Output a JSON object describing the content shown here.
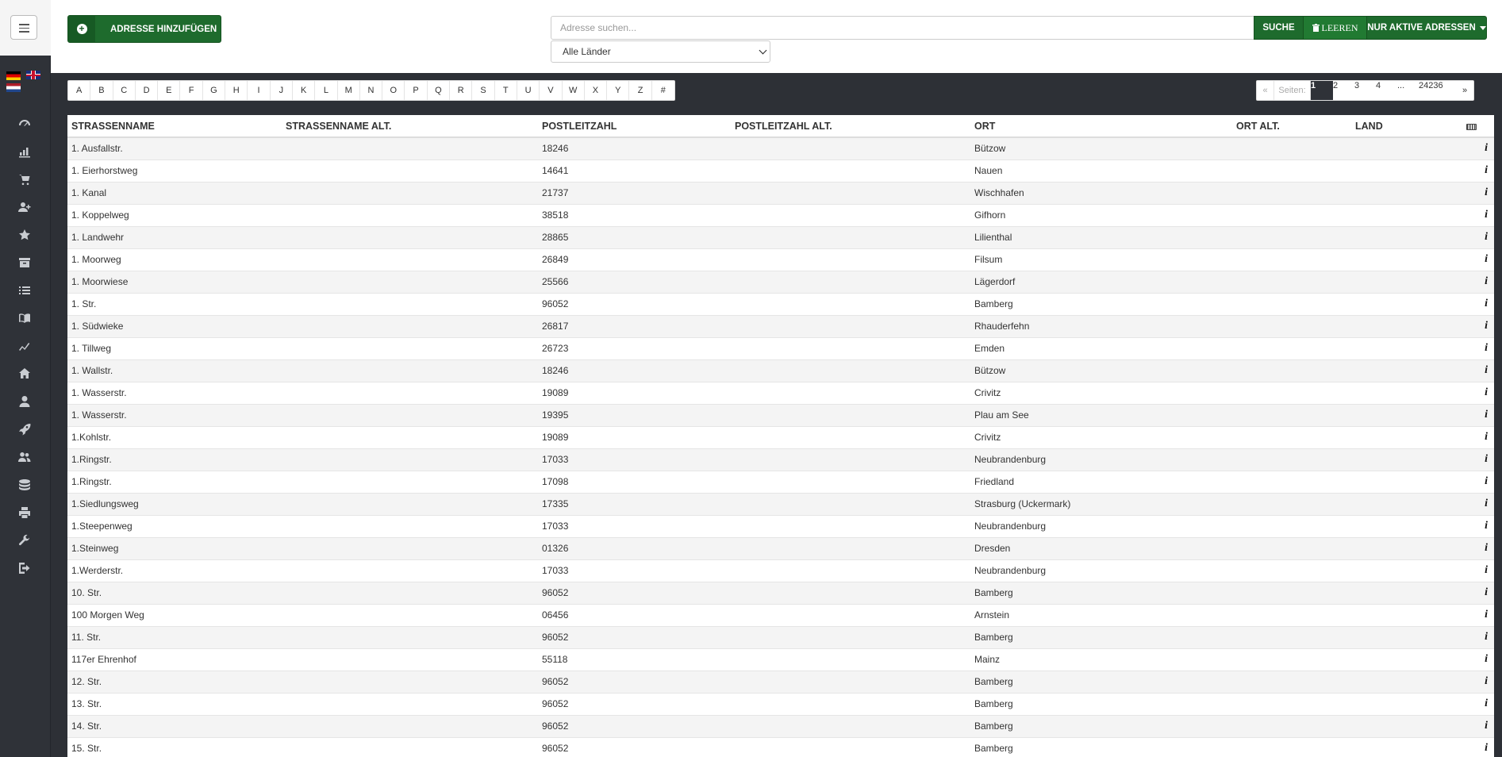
{
  "header": {
    "add_button_label": "ADRESSE HINZUFÜGEN",
    "search_placeholder": "Adresse suchen...",
    "search_value": "",
    "search_button_label": "SUCHE",
    "clear_button_label": "LEEREN",
    "active_filter_label": "NUR AKTIVE ADRESSEN",
    "country_selected": "Alle Länder"
  },
  "sidebar": {
    "languages": [
      "de",
      "en",
      "nl"
    ],
    "icons": [
      "dashboard-icon",
      "bar-chart-icon",
      "cart-icon",
      "user-plus-icon",
      "star-icon",
      "archive-icon",
      "list-icon",
      "book-icon",
      "line-chart-icon",
      "home-icon",
      "user-icon",
      "rocket-icon",
      "users-icon",
      "database-icon",
      "print-icon",
      "wrench-icon",
      "logout-icon"
    ]
  },
  "alphabet": [
    "A",
    "B",
    "C",
    "D",
    "E",
    "F",
    "G",
    "H",
    "I",
    "J",
    "K",
    "L",
    "M",
    "N",
    "O",
    "P",
    "Q",
    "R",
    "S",
    "T",
    "U",
    "V",
    "W",
    "X",
    "Y",
    "Z",
    "#"
  ],
  "pagination": {
    "prev": "«",
    "label": "Seiten:",
    "pages": [
      "1",
      "2",
      "3",
      "4",
      "...",
      "24236"
    ],
    "current": "1",
    "next": "»"
  },
  "table": {
    "columns": [
      "STRASSENNAME",
      "STRASSENNAME ALT.",
      "POSTLEITZAHL",
      "POSTLEITZAHL ALT.",
      "ORT",
      "ORT ALT.",
      "LAND"
    ],
    "rows": [
      [
        "1. Ausfallstr.",
        "",
        "18246",
        "",
        "Bützow",
        "",
        ""
      ],
      [
        "1. Eierhorstweg",
        "",
        "14641",
        "",
        "Nauen",
        "",
        ""
      ],
      [
        "1. Kanal",
        "",
        "21737",
        "",
        "Wischhafen",
        "",
        ""
      ],
      [
        "1. Koppelweg",
        "",
        "38518",
        "",
        "Gifhorn",
        "",
        ""
      ],
      [
        "1. Landwehr",
        "",
        "28865",
        "",
        "Lilienthal",
        "",
        ""
      ],
      [
        "1. Moorweg",
        "",
        "26849",
        "",
        "Filsum",
        "",
        ""
      ],
      [
        "1. Moorwiese",
        "",
        "25566",
        "",
        "Lägerdorf",
        "",
        ""
      ],
      [
        "1. Str.",
        "",
        "96052",
        "",
        "Bamberg",
        "",
        ""
      ],
      [
        "1. Südwieke",
        "",
        "26817",
        "",
        "Rhauderfehn",
        "",
        ""
      ],
      [
        "1. Tillweg",
        "",
        "26723",
        "",
        "Emden",
        "",
        ""
      ],
      [
        "1. Wallstr.",
        "",
        "18246",
        "",
        "Bützow",
        "",
        ""
      ],
      [
        "1. Wasserstr.",
        "",
        "19089",
        "",
        "Crivitz",
        "",
        ""
      ],
      [
        "1. Wasserstr.",
        "",
        "19395",
        "",
        "Plau am See",
        "",
        ""
      ],
      [
        "1.Kohlstr.",
        "",
        "19089",
        "",
        "Crivitz",
        "",
        ""
      ],
      [
        "1.Ringstr.",
        "",
        "17033",
        "",
        "Neubrandenburg",
        "",
        ""
      ],
      [
        "1.Ringstr.",
        "",
        "17098",
        "",
        "Friedland",
        "",
        ""
      ],
      [
        "1.Siedlungsweg",
        "",
        "17335",
        "",
        "Strasburg (Uckermark)",
        "",
        ""
      ],
      [
        "1.Steepenweg",
        "",
        "17033",
        "",
        "Neubrandenburg",
        "",
        ""
      ],
      [
        "1.Steinweg",
        "",
        "01326",
        "",
        "Dresden",
        "",
        ""
      ],
      [
        "1.Werderstr.",
        "",
        "17033",
        "",
        "Neubrandenburg",
        "",
        ""
      ],
      [
        "10. Str.",
        "",
        "96052",
        "",
        "Bamberg",
        "",
        ""
      ],
      [
        "100 Morgen Weg",
        "",
        "06456",
        "",
        "Arnstein",
        "",
        ""
      ],
      [
        "11. Str.",
        "",
        "96052",
        "",
        "Bamberg",
        "",
        ""
      ],
      [
        "117er Ehrenhof",
        "",
        "55118",
        "",
        "Mainz",
        "",
        ""
      ],
      [
        "12. Str.",
        "",
        "96052",
        "",
        "Bamberg",
        "",
        ""
      ],
      [
        "13. Str.",
        "",
        "96052",
        "",
        "Bamberg",
        "",
        ""
      ],
      [
        "14. Str.",
        "",
        "96052",
        "",
        "Bamberg",
        "",
        ""
      ],
      [
        "15. Str.",
        "",
        "96052",
        "",
        "Bamberg",
        "",
        ""
      ]
    ],
    "info_label": "i"
  },
  "colors": {
    "primary_green": "#1e6b2d",
    "sidebar_dark": "#2f3238"
  }
}
